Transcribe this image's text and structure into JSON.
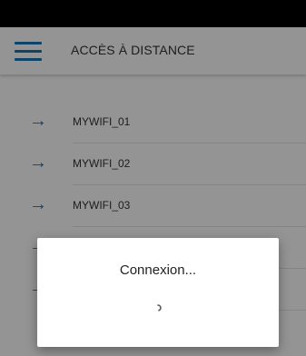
{
  "app_bar": {
    "title": "ACCÈS À DISTANCE",
    "menu_icon": "hamburger-menu-icon"
  },
  "networks": [
    {
      "name": "MYWIFI_01",
      "icon": "arrow-right-icon"
    },
    {
      "name": "MYWIFI_02",
      "icon": "arrow-right-icon"
    },
    {
      "name": "MYWIFI_03",
      "icon": "arrow-right-icon"
    },
    {
      "name": "",
      "icon": "arrow-right-icon"
    },
    {
      "name": "",
      "icon": "arrow-right-icon"
    }
  ],
  "dialog": {
    "message": "Connexion...",
    "spinner_icon": "loading-spinner-icon"
  },
  "colors": {
    "accent": "#1976b5",
    "status_bar": "#000000",
    "overlay": "rgba(0,0,0,0.42)"
  }
}
